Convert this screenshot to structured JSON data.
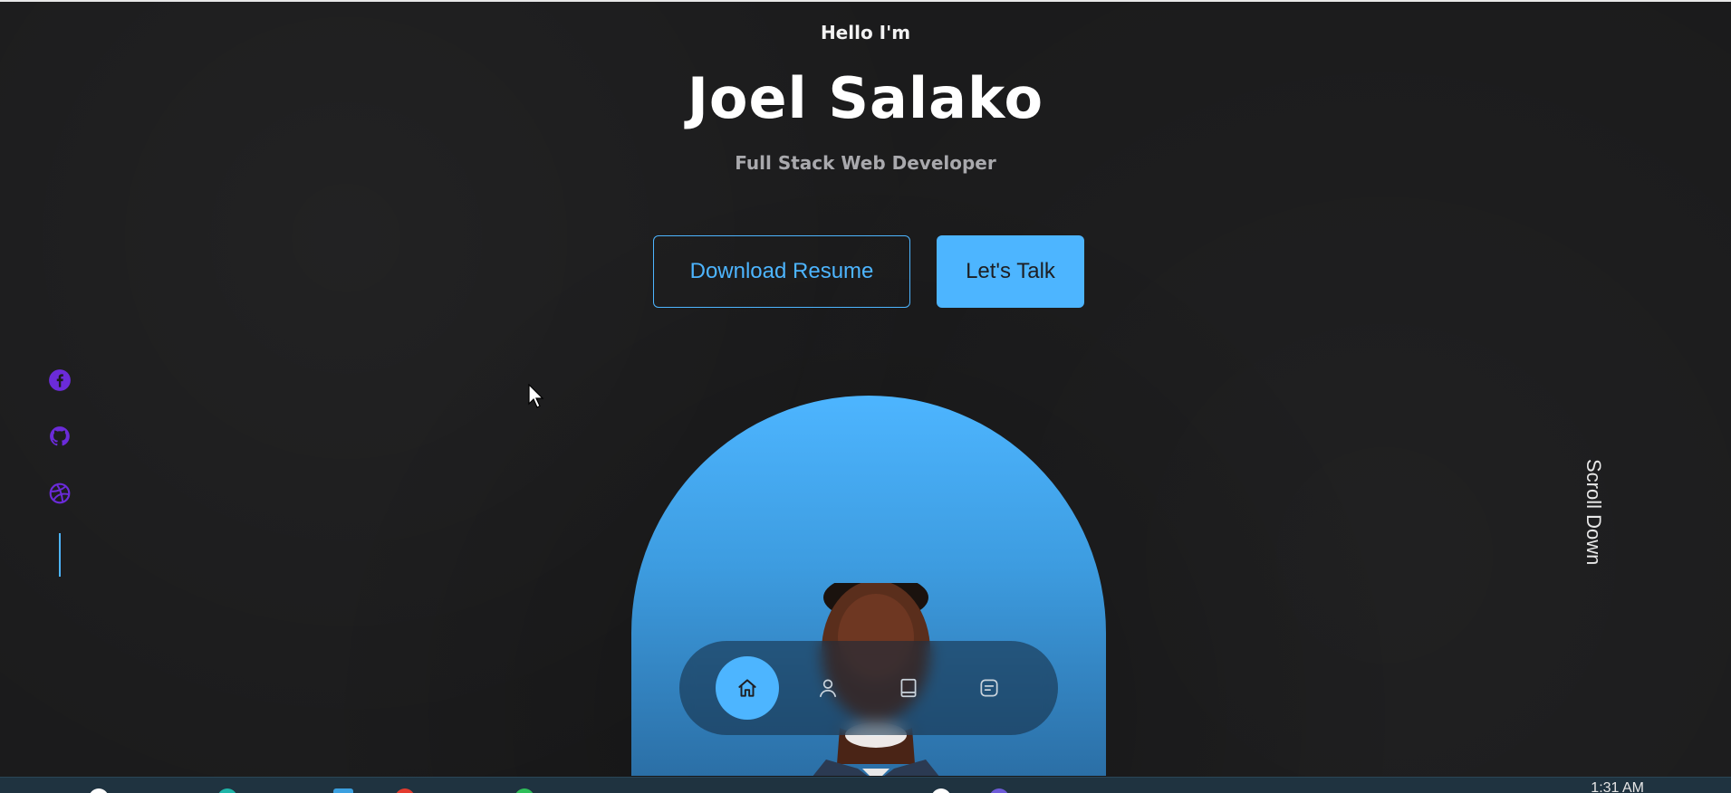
{
  "hero": {
    "greeting": "Hello I'm",
    "name": "Joel Salako",
    "role": "Full Stack Web Developer",
    "download_label": "Download Resume",
    "talk_label": "Let's Talk"
  },
  "socials": [
    {
      "icon": "facebook-icon"
    },
    {
      "icon": "github-icon"
    },
    {
      "icon": "dribbble-icon"
    }
  ],
  "scroll_label": "Scroll Down",
  "nav": [
    {
      "icon": "home-icon",
      "active": true
    },
    {
      "icon": "user-icon",
      "active": false
    },
    {
      "icon": "book-icon",
      "active": false
    },
    {
      "icon": "message-icon",
      "active": false
    }
  ],
  "taskbar": {
    "time": "1:31 AM"
  },
  "colors": {
    "accent": "#4db5ff",
    "social": "#6b2bd9",
    "background": "#1b1b1c"
  }
}
